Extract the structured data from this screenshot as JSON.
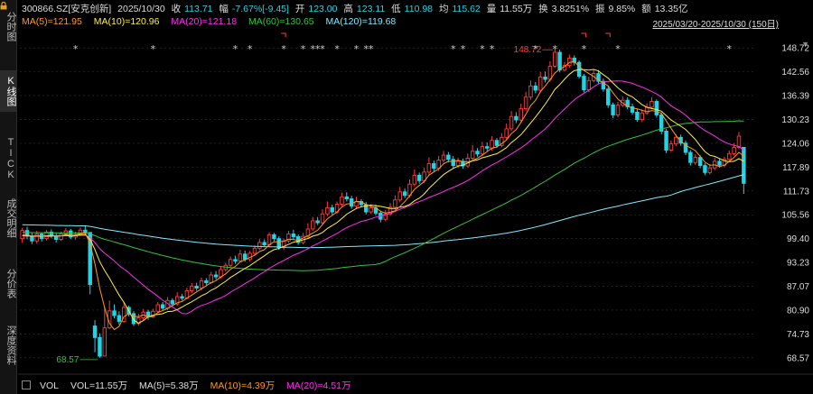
{
  "sidebar": {
    "tabs": [
      "分时图",
      "K线图",
      "TICK",
      "成交明细",
      "分价表",
      "深度资料"
    ],
    "active": 1
  },
  "header": {
    "code": "300866.SZ[安克创新]",
    "date": "2025/10/30",
    "close_label": "收",
    "close": "113.71",
    "change_label": "幅",
    "change": "-7.67%[-9.45]",
    "open_label": "开",
    "open": "123.00",
    "high_label": "高",
    "high": "123.11",
    "low_label": "低",
    "low": "110.98",
    "avg_label": "均",
    "avg": "115.62",
    "vol_label": "量",
    "vol": "11.55万",
    "turnover_label": "换",
    "turnover": "3.8251%",
    "amp_label": "振",
    "amp": "9.85%",
    "amount_label": "额",
    "amount": "13.35亿"
  },
  "ma": {
    "ma5": "MA(5)=121.95",
    "ma10": "MA(10)=120.96",
    "ma20": "MA(20)=121.18",
    "ma60": "MA(60)=130.65",
    "ma120": "MA(120)=119.68"
  },
  "range_text": "2025/03/20-2025/10/30 (150日)",
  "volume": {
    "label": "VOL",
    "vol": "VOL=11.55万",
    "ma5": "MA(5)=5.38万",
    "ma10": "MA(10)=4.39万",
    "ma20": "MA(20)=4.51万"
  },
  "colors": {
    "up": "#ff3b3b",
    "down": "#22d4e6",
    "ma5": "#ff9a1f",
    "ma10": "#ffef3a",
    "ma20": "#ff2df0",
    "ma60": "#35c23a",
    "ma120": "#7fe9ff",
    "grid": "#333333"
  },
  "chart_data": {
    "type": "candlestick",
    "y_ticks": [
      "148.72",
      "142.56",
      "136.39",
      "130.23",
      "124.06",
      "117.89",
      "111.73",
      "105.56",
      "99.40",
      "93.23",
      "87.07",
      "80.90",
      "74.73",
      "68.57"
    ],
    "ylim": [
      65.5,
      151.8
    ],
    "max_label": "148.72",
    "min_label": "68.57",
    "n_days": 150,
    "candles": [
      [
        99.4,
        101.5,
        98.4,
        102.2
      ],
      [
        101.5,
        100.0,
        99.2,
        102.5
      ],
      [
        100.0,
        98.8,
        98.0,
        101.0
      ],
      [
        98.8,
        100.6,
        98.1,
        101.4
      ],
      [
        100.6,
        99.4,
        98.6,
        101.0
      ],
      [
        99.4,
        101.1,
        98.9,
        101.6
      ],
      [
        101.1,
        100.1,
        99.5,
        101.8
      ],
      [
        100.1,
        99.2,
        98.4,
        100.9
      ],
      [
        99.2,
        100.6,
        98.8,
        101.2
      ],
      [
        100.6,
        101.4,
        100.0,
        102.1
      ],
      [
        101.4,
        99.8,
        99.3,
        101.9
      ],
      [
        99.8,
        100.5,
        99.1,
        101.2
      ],
      [
        100.5,
        101.6,
        100.1,
        102.3
      ],
      [
        101.6,
        101.0,
        100.4,
        102.7
      ],
      [
        101.0,
        87.5,
        85.0,
        101.0
      ],
      [
        76.8,
        73.8,
        70.0,
        78.3
      ],
      [
        73.8,
        69.0,
        68.57,
        74.9
      ],
      [
        69.0,
        76.3,
        68.9,
        81.8
      ],
      [
        76.3,
        80.7,
        76.0,
        83.4
      ],
      [
        80.7,
        79.5,
        78.8,
        82.4
      ],
      [
        79.5,
        78.0,
        77.1,
        80.6
      ],
      [
        78.0,
        81.6,
        77.6,
        83.1
      ],
      [
        81.6,
        80.0,
        79.3,
        82.1
      ],
      [
        80.0,
        77.4,
        76.8,
        80.6
      ],
      [
        77.4,
        78.9,
        76.9,
        80.0
      ],
      [
        78.9,
        80.4,
        78.3,
        81.2
      ],
      [
        80.4,
        79.1,
        78.4,
        81.0
      ],
      [
        79.1,
        80.6,
        78.9,
        81.3
      ],
      [
        80.6,
        82.3,
        80.2,
        83.0
      ],
      [
        82.3,
        81.4,
        80.8,
        83.0
      ],
      [
        81.4,
        83.4,
        80.9,
        84.3
      ],
      [
        83.4,
        82.5,
        81.9,
        84.0
      ],
      [
        82.5,
        84.4,
        82.0,
        85.5
      ],
      [
        84.4,
        84.0,
        83.4,
        85.1
      ],
      [
        84.0,
        85.9,
        83.7,
        86.7
      ],
      [
        85.9,
        87.1,
        85.3,
        87.9
      ],
      [
        87.1,
        86.6,
        85.9,
        88.0
      ],
      [
        86.6,
        88.5,
        86.0,
        89.3
      ],
      [
        88.5,
        88.0,
        87.4,
        89.2
      ],
      [
        88.0,
        90.0,
        87.7,
        90.8
      ],
      [
        90.0,
        89.5,
        88.8,
        91.0
      ],
      [
        89.5,
        91.4,
        89.0,
        92.2
      ],
      [
        91.4,
        92.5,
        90.8,
        93.2
      ],
      [
        92.5,
        94.0,
        92.0,
        94.8
      ],
      [
        94.0,
        93.6,
        92.9,
        95.0
      ],
      [
        93.6,
        95.4,
        93.3,
        96.5
      ],
      [
        95.4,
        94.0,
        93.4,
        96.3
      ],
      [
        94.0,
        95.6,
        93.5,
        96.2
      ],
      [
        95.6,
        96.9,
        95.1,
        97.6
      ],
      [
        96.9,
        98.4,
        96.4,
        99.3
      ],
      [
        98.4,
        97.8,
        97.2,
        99.2
      ],
      [
        97.8,
        100.4,
        97.4,
        101.0
      ],
      [
        100.4,
        99.4,
        98.7,
        100.9
      ],
      [
        99.4,
        97.1,
        96.5,
        100.0
      ],
      [
        97.1,
        98.8,
        96.5,
        99.4
      ],
      [
        98.8,
        100.6,
        98.3,
        101.4
      ],
      [
        100.6,
        99.9,
        99.2,
        101.7
      ],
      [
        99.9,
        98.4,
        97.8,
        100.5
      ],
      [
        98.4,
        100.0,
        97.9,
        100.9
      ],
      [
        100.0,
        101.9,
        99.6,
        103.4
      ],
      [
        101.9,
        104.0,
        101.4,
        105.0
      ],
      [
        104.0,
        103.5,
        102.9,
        105.0
      ],
      [
        103.5,
        105.8,
        103.0,
        107.0
      ],
      [
        105.8,
        107.4,
        105.2,
        109.0
      ],
      [
        107.4,
        106.3,
        105.6,
        108.2
      ],
      [
        106.3,
        108.3,
        105.8,
        109.0
      ],
      [
        108.3,
        110.2,
        107.8,
        111.3
      ],
      [
        110.2,
        109.7,
        109.0,
        111.4
      ],
      [
        109.7,
        107.8,
        107.1,
        110.5
      ],
      [
        107.8,
        109.0,
        107.2,
        110.2
      ],
      [
        109.0,
        108.2,
        107.5,
        109.6
      ],
      [
        108.2,
        106.3,
        105.6,
        108.9
      ],
      [
        106.3,
        107.4,
        105.8,
        108.3
      ],
      [
        107.4,
        106.0,
        105.4,
        108.2
      ],
      [
        106.0,
        104.4,
        103.6,
        106.6
      ],
      [
        104.4,
        105.8,
        103.9,
        106.8
      ],
      [
        105.8,
        107.5,
        105.3,
        108.6
      ],
      [
        107.5,
        109.4,
        106.9,
        110.6
      ],
      [
        109.4,
        111.5,
        108.8,
        112.8
      ],
      [
        111.5,
        110.6,
        109.9,
        112.4
      ],
      [
        110.6,
        113.5,
        110.0,
        114.7
      ],
      [
        113.5,
        115.8,
        112.9,
        117.3
      ],
      [
        115.8,
        114.4,
        113.6,
        116.5
      ],
      [
        114.4,
        116.6,
        113.8,
        117.8
      ],
      [
        116.6,
        118.8,
        116.0,
        120.4
      ],
      [
        118.8,
        117.6,
        116.8,
        119.6
      ],
      [
        117.6,
        119.7,
        116.9,
        120.8
      ],
      [
        119.7,
        121.0,
        119.1,
        122.1
      ],
      [
        121.0,
        119.9,
        119.1,
        121.8
      ],
      [
        119.9,
        118.3,
        117.6,
        120.8
      ],
      [
        118.3,
        119.4,
        117.7,
        120.3
      ],
      [
        119.4,
        118.2,
        117.5,
        120.1
      ],
      [
        118.2,
        120.2,
        117.7,
        121.4
      ],
      [
        120.2,
        122.0,
        119.7,
        123.6
      ],
      [
        122.0,
        121.3,
        120.6,
        122.8
      ],
      [
        121.3,
        123.2,
        120.8,
        124.4
      ],
      [
        123.2,
        122.8,
        122.1,
        124.3
      ],
      [
        122.8,
        124.8,
        122.2,
        125.9
      ],
      [
        124.8,
        123.5,
        122.8,
        125.4
      ],
      [
        123.5,
        125.6,
        123.0,
        126.7
      ],
      [
        125.6,
        127.8,
        125.0,
        129.2
      ],
      [
        127.8,
        131.0,
        127.2,
        132.4
      ],
      [
        131.0,
        130.1,
        129.3,
        132.1
      ],
      [
        130.1,
        133.0,
        129.5,
        134.3
      ],
      [
        133.0,
        136.0,
        132.4,
        137.4
      ],
      [
        136.0,
        138.9,
        135.3,
        140.3
      ],
      [
        138.9,
        137.8,
        137.0,
        139.9
      ],
      [
        137.8,
        141.2,
        137.2,
        142.5
      ],
      [
        141.2,
        140.6,
        139.8,
        142.6
      ],
      [
        140.6,
        144.0,
        140.0,
        145.3
      ],
      [
        144.0,
        147.6,
        143.6,
        148.72
      ],
      [
        147.6,
        143.0,
        142.4,
        148.3
      ],
      [
        143.0,
        144.2,
        142.6,
        145.1
      ],
      [
        144.2,
        146.1,
        143.6,
        147.0
      ],
      [
        146.1,
        145.0,
        144.2,
        146.8
      ],
      [
        145.0,
        141.4,
        140.8,
        145.5
      ],
      [
        141.4,
        137.9,
        137.2,
        142.0
      ],
      [
        137.9,
        140.3,
        137.3,
        141.3
      ],
      [
        140.3,
        142.1,
        139.8,
        143.2
      ],
      [
        142.1,
        140.1,
        139.5,
        143.0
      ],
      [
        140.1,
        138.1,
        137.4,
        140.8
      ],
      [
        138.1,
        134.0,
        133.2,
        138.8
      ],
      [
        134.0,
        131.4,
        130.6,
        134.6
      ],
      [
        131.4,
        133.9,
        130.8,
        134.8
      ],
      [
        133.9,
        135.2,
        133.4,
        136.2
      ],
      [
        135.2,
        133.5,
        132.9,
        136.0
      ],
      [
        133.5,
        132.1,
        131.4,
        134.3
      ],
      [
        132.1,
        130.2,
        129.6,
        133.0
      ],
      [
        130.2,
        131.9,
        129.6,
        132.8
      ],
      [
        131.9,
        133.4,
        131.4,
        134.4
      ],
      [
        133.4,
        134.9,
        132.9,
        136.0
      ],
      [
        134.9,
        131.4,
        130.7,
        135.4
      ],
      [
        131.4,
        127.2,
        126.4,
        132.0
      ],
      [
        127.2,
        122.3,
        121.5,
        127.8
      ],
      [
        122.3,
        123.9,
        121.8,
        124.8
      ],
      [
        123.9,
        125.6,
        123.3,
        126.4
      ],
      [
        125.6,
        124.1,
        123.4,
        126.3
      ],
      [
        124.1,
        121.7,
        121.0,
        124.8
      ],
      [
        121.7,
        119.1,
        118.3,
        122.3
      ],
      [
        119.1,
        120.4,
        118.5,
        121.2
      ],
      [
        120.4,
        118.3,
        117.6,
        121.0
      ],
      [
        118.3,
        116.5,
        115.8,
        118.9
      ],
      [
        116.5,
        117.7,
        116.0,
        118.6
      ],
      [
        117.7,
        119.4,
        117.1,
        120.3
      ],
      [
        119.4,
        118.4,
        117.8,
        120.1
      ],
      [
        118.4,
        119.9,
        117.9,
        120.6
      ],
      [
        119.9,
        121.4,
        119.4,
        122.2
      ],
      [
        121.4,
        123.0,
        120.9,
        124.1
      ],
      [
        123.0,
        125.9,
        122.5,
        127.0
      ],
      [
        123.0,
        113.71,
        110.98,
        123.11
      ]
    ],
    "ma5_last": 121.95,
    "ma10_last": 120.96,
    "ma20_last": 121.18,
    "ma60_last": 130.65,
    "ma120_last": 119.68,
    "star_markers": [
      11,
      27,
      44,
      47,
      54,
      58,
      60,
      61,
      62,
      65,
      69,
      71,
      72,
      89,
      91,
      95,
      97,
      106,
      110,
      116,
      123,
      146
    ],
    "bracket_markers": [
      54,
      116,
      121
    ]
  }
}
